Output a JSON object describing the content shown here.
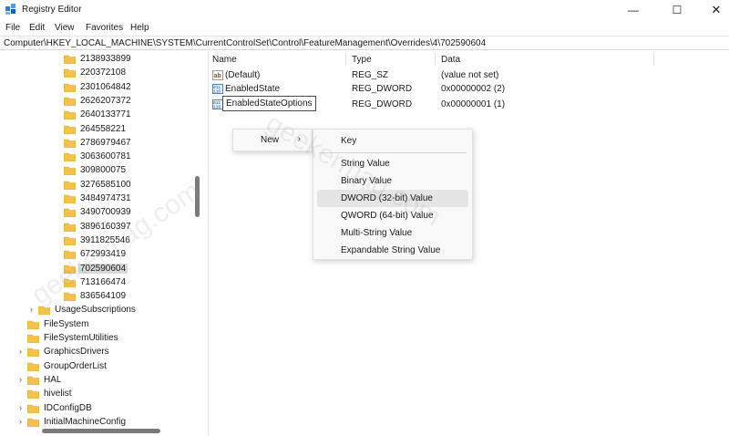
{
  "window": {
    "title": "Registry Editor",
    "controls": {
      "minimize": "—",
      "maximize": "☐",
      "close": "✕"
    }
  },
  "menu": [
    "File",
    "Edit",
    "View",
    "Favorites",
    "Help"
  ],
  "address": "Computer\\HKEY_LOCAL_MACHINE\\SYSTEM\\CurrentControlSet\\Control\\FeatureManagement\\Overrides\\4\\702590604",
  "tree": {
    "subkeys": [
      "2138933899",
      "220372108",
      "2301064842",
      "2626207372",
      "2640133771",
      "264558221",
      "2786979467",
      "3063600781",
      "309800075",
      "3276585100",
      "3484974731",
      "3490700939",
      "3896160397",
      "3911825546",
      "672993419",
      "702590604",
      "713166474",
      "836564109"
    ],
    "selected": "702590604",
    "usage_subscriptions": "UsageSubscriptions",
    "root_keys": [
      "FileSystem",
      "FileSystemUtilities",
      "GraphicsDrivers",
      "GroupOrderList",
      "HAL",
      "hivelist",
      "IDConfigDB",
      "InitialMachineConfig"
    ]
  },
  "list": {
    "headers": {
      "name": "Name",
      "type": "Type",
      "data": "Data"
    },
    "rows": [
      {
        "name": "(Default)",
        "type": "REG_SZ",
        "data": "(value not set)",
        "icon": "ab-string-icon"
      },
      {
        "name": "EnabledState",
        "type": "REG_DWORD",
        "data": "0x00000002 (2)",
        "icon": "binary-value-icon"
      },
      {
        "name": "EnabledStateOptions",
        "type": "REG_DWORD",
        "data": "0x00000001 (1)",
        "icon": "binary-value-icon"
      }
    ]
  },
  "context_menu": {
    "new": "New",
    "arrow": "›"
  },
  "submenu": {
    "key": "Key",
    "items": [
      "String Value",
      "Binary Value",
      "DWORD (32-bit) Value",
      "QWORD (64-bit) Value",
      "Multi-String Value",
      "Expandable String Value"
    ],
    "highlighted": "DWORD (32-bit) Value"
  },
  "watermark": "geekermag.com",
  "colors": {
    "folder": "#f2c14e",
    "folder_dark": "#dca93a",
    "selection": "#d9d9d9",
    "highlight": "#e5e5e5",
    "scrollbar": "#7a7a7a"
  }
}
